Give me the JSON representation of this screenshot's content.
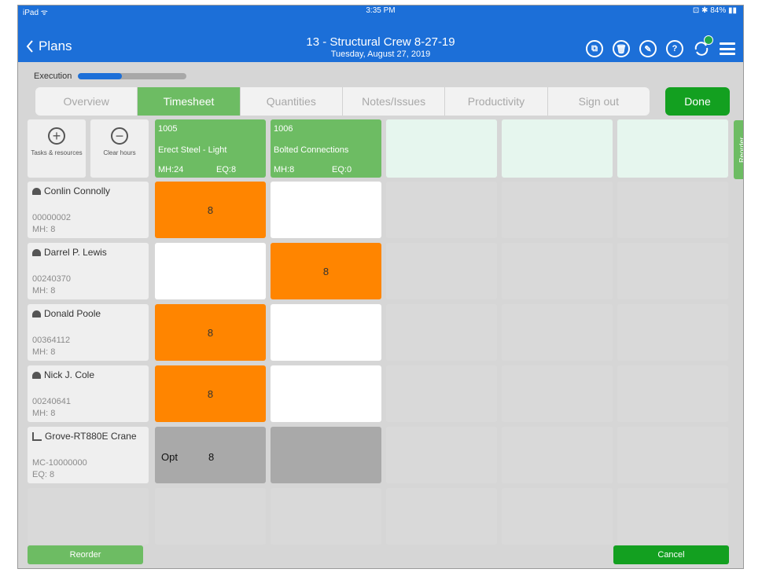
{
  "status_bar": {
    "carrier": "iPad ᯤ",
    "time": "3:35 PM",
    "battery": "⊡ ✱ 84% ▮▮"
  },
  "nav": {
    "back_label": "Plans",
    "title": "13 - Structural Crew 8-27-19",
    "subtitle": "Tuesday, August 27, 2019"
  },
  "execution": {
    "label": "Execution",
    "progress": 0.4
  },
  "tabs": [
    {
      "label": "Overview",
      "active": false
    },
    {
      "label": "Timesheet",
      "active": true
    },
    {
      "label": "Quantities",
      "active": false
    },
    {
      "label": "Notes/Issues",
      "active": false
    },
    {
      "label": "Productivity",
      "active": false
    },
    {
      "label": "Sign out",
      "active": false
    }
  ],
  "done_label": "Done",
  "tools": {
    "add_label": "Tasks & resources",
    "clear_label": "Clear hours"
  },
  "tasks": [
    {
      "code": "1005",
      "name": "Erect Steel - Light",
      "mh": "MH:24",
      "eq": "EQ:8"
    },
    {
      "code": "1006",
      "name": "Bolted Connections",
      "mh": "MH:8",
      "eq": "EQ:0"
    }
  ],
  "side_reorder_label": "Reorder",
  "resources": [
    {
      "name": "Conlin Connolly",
      "id": "00000002",
      "hours": "MH: 8",
      "type": "worker",
      "cells": [
        {
          "value": "8",
          "style": "orange"
        },
        {
          "value": "",
          "style": "white"
        }
      ]
    },
    {
      "name": "Darrel P. Lewis",
      "id": "00240370",
      "hours": "MH: 8",
      "type": "worker",
      "cells": [
        {
          "value": "",
          "style": "white"
        },
        {
          "value": "8",
          "style": "orange"
        }
      ]
    },
    {
      "name": "Donald Poole",
      "id": "00364112",
      "hours": "MH: 8",
      "type": "worker",
      "cells": [
        {
          "value": "8",
          "style": "orange"
        },
        {
          "value": "",
          "style": "white"
        }
      ]
    },
    {
      "name": "Nick J. Cole",
      "id": "00240641",
      "hours": "MH: 8",
      "type": "worker",
      "cells": [
        {
          "value": "8",
          "style": "orange"
        },
        {
          "value": "",
          "style": "white"
        }
      ]
    },
    {
      "name": "Grove-RT880E Crane",
      "id": "MC-10000000",
      "hours": "EQ: 8",
      "type": "equipment",
      "cells": [
        {
          "value": "8",
          "style": "gray",
          "prefix": "Opt"
        },
        {
          "value": "",
          "style": "gray"
        }
      ]
    }
  ],
  "bottom": {
    "reorder_label": "Reorder",
    "cancel_label": "Cancel"
  },
  "colors": {
    "nav_blue": "#1c6fd8",
    "task_green": "#6dbc63",
    "done_green": "#13a020",
    "hours_orange": "#ff8500"
  }
}
